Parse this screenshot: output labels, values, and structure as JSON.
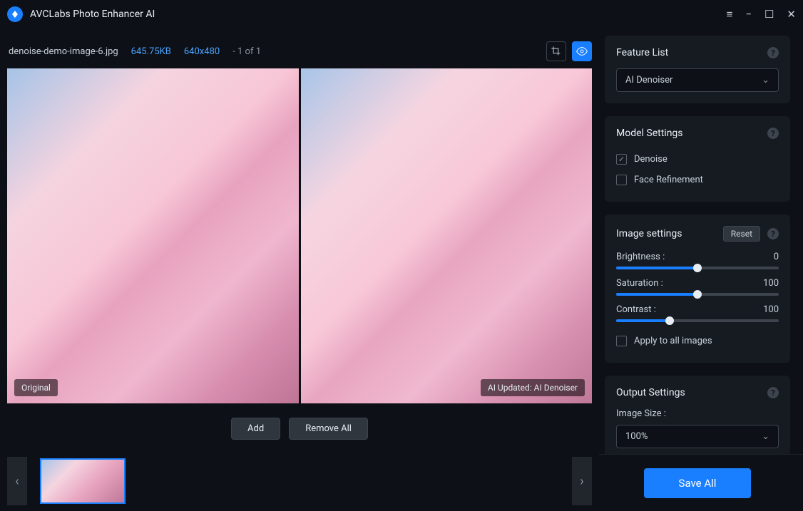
{
  "app": {
    "title": "AVCLabs Photo Enhancer AI"
  },
  "file": {
    "name": "denoise-demo-image-6.jpg",
    "size": "645.75KB",
    "dims": "640x480",
    "count": "- 1 of 1"
  },
  "preview": {
    "original_label": "Original",
    "updated_label": "AI Updated: AI Denoiser"
  },
  "actions": {
    "add": "Add",
    "remove": "Remove All",
    "save": "Save All"
  },
  "sidebar": {
    "feature": {
      "title": "Feature List",
      "selected": "AI Denoiser"
    },
    "model": {
      "title": "Model Settings",
      "denoise": "Denoise",
      "face": "Face Refinement"
    },
    "image": {
      "title": "Image settings",
      "reset": "Reset",
      "brightness": {
        "label": "Brightness :",
        "value": "0",
        "pct": 50
      },
      "saturation": {
        "label": "Saturation :",
        "value": "100",
        "pct": 50
      },
      "contrast": {
        "label": "Contrast :",
        "value": "100",
        "pct": 33
      },
      "apply_all": "Apply to all images"
    },
    "output": {
      "title": "Output Settings",
      "size_label": "Image Size :",
      "size_value": "100%"
    }
  }
}
